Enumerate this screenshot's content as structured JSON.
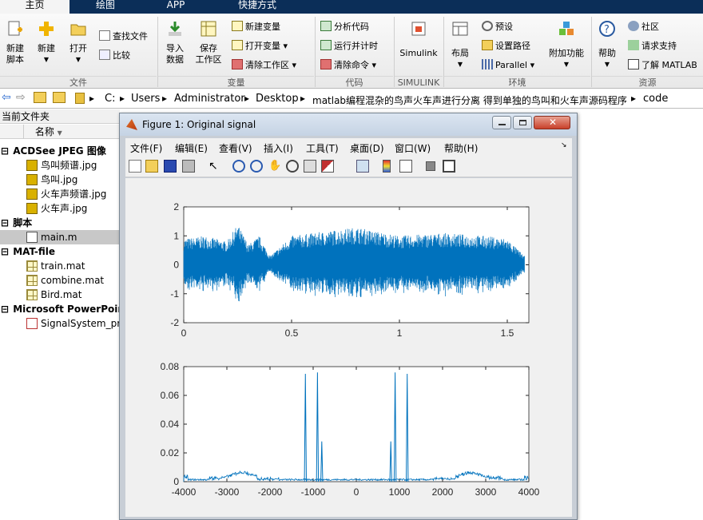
{
  "tabs": [
    {
      "label": "主页"
    },
    {
      "label": "绘图"
    },
    {
      "label": "APP"
    },
    {
      "label": "快捷方式"
    }
  ],
  "ribbon": {
    "file": {
      "new_script": "新建\n脚本",
      "new": "新建",
      "open": "打开",
      "find_files": "查找文件",
      "compare": "比较",
      "group": "文件"
    },
    "variable": {
      "import": "导入\n数据",
      "save_ws": "保存\n工作区",
      "new_var": "新建变量",
      "open_var": "打开变量",
      "clear_ws": "清除工作区",
      "group": "变量"
    },
    "code": {
      "analyze": "分析代码",
      "run_time": "运行并计时",
      "clear_cmd": "清除命令",
      "group": "代码"
    },
    "simulink": {
      "simulink": "Simulink",
      "group": "SIMULINK"
    },
    "env": {
      "layout": "布局",
      "prefs": "预设",
      "set_path": "设置路径",
      "parallel": "Parallel",
      "addons": "附加功能",
      "group": "环境"
    },
    "resources": {
      "help": "帮助",
      "community": "社区",
      "support": "请求支持",
      "learn": "了解 MATLAB",
      "group": "资源"
    }
  },
  "address": {
    "crumbs": [
      "C:",
      "Users",
      "Administrator",
      "Desktop",
      "matlab编程混杂的鸟声火车声进行分离 得到单独的鸟叫和火车声源码程序",
      "code"
    ]
  },
  "current_folder": {
    "title": "当前文件夹",
    "column": "名称",
    "groups": [
      {
        "name": "ACDSee JPEG 图像",
        "files": [
          "鸟叫频谱.jpg",
          "鸟叫.jpg",
          "火车声频谱.jpg",
          "火车声.jpg"
        ]
      },
      {
        "name": "脚本",
        "files": [
          "main.m"
        ]
      },
      {
        "name": "MAT-file",
        "files": [
          "train.mat",
          "combine.mat",
          "Bird.mat"
        ]
      },
      {
        "name": "Microsoft PowerPoint",
        "files": [
          "SignalSystem_pr"
        ]
      }
    ]
  },
  "figure": {
    "title": "Figure 1: Original signal",
    "menu": [
      "文件(F)",
      "编辑(E)",
      "查看(V)",
      "插入(I)",
      "工具(T)",
      "桌面(D)",
      "窗口(W)",
      "帮助(H)"
    ]
  },
  "colors": {
    "signal": "#0072bd",
    "ribbon_dark": "#0b2e58"
  },
  "chart_data": [
    {
      "type": "line",
      "title": "",
      "xlabel": "",
      "ylabel": "",
      "xlim": [
        0,
        1.6
      ],
      "ylim": [
        -2,
        2
      ],
      "xticks": [
        0,
        0.5,
        1,
        1.5
      ],
      "yticks": [
        -2,
        -1,
        0,
        1,
        2
      ],
      "series": [
        {
          "values_description_note": "",
          "x": [
            0,
            0.1,
            0.2,
            0.25,
            0.3,
            0.35,
            0.4,
            0.5,
            0.6,
            0.8,
            1.0,
            1.2,
            1.4,
            1.5,
            1.58
          ],
          "envelope": [
            0.9,
            1.0,
            0.8,
            1.4,
            0.7,
            1.0,
            0.3,
            1.0,
            1.1,
            1.3,
            1.0,
            1.1,
            1.0,
            0.9,
            0.3
          ]
        }
      ]
    },
    {
      "type": "line",
      "title": "",
      "xlabel": "",
      "ylabel": "",
      "xlim": [
        -4000,
        4000
      ],
      "ylim": [
        0,
        0.08
      ],
      "xticks": [
        -4000,
        -3000,
        -2000,
        -1000,
        0,
        1000,
        2000,
        3000,
        4000
      ],
      "yticks": [
        0,
        0.02,
        0.04,
        0.06,
        0.08
      ],
      "series": [
        {
          "peaks": [
            {
              "x": -1180,
              "y": 0.075
            },
            {
              "x": -900,
              "y": 0.076
            },
            {
              "x": -800,
              "y": 0.028
            },
            {
              "x": 800,
              "y": 0.028
            },
            {
              "x": 900,
              "y": 0.076
            },
            {
              "x": 1180,
              "y": 0.075
            }
          ]
        }
      ]
    }
  ]
}
